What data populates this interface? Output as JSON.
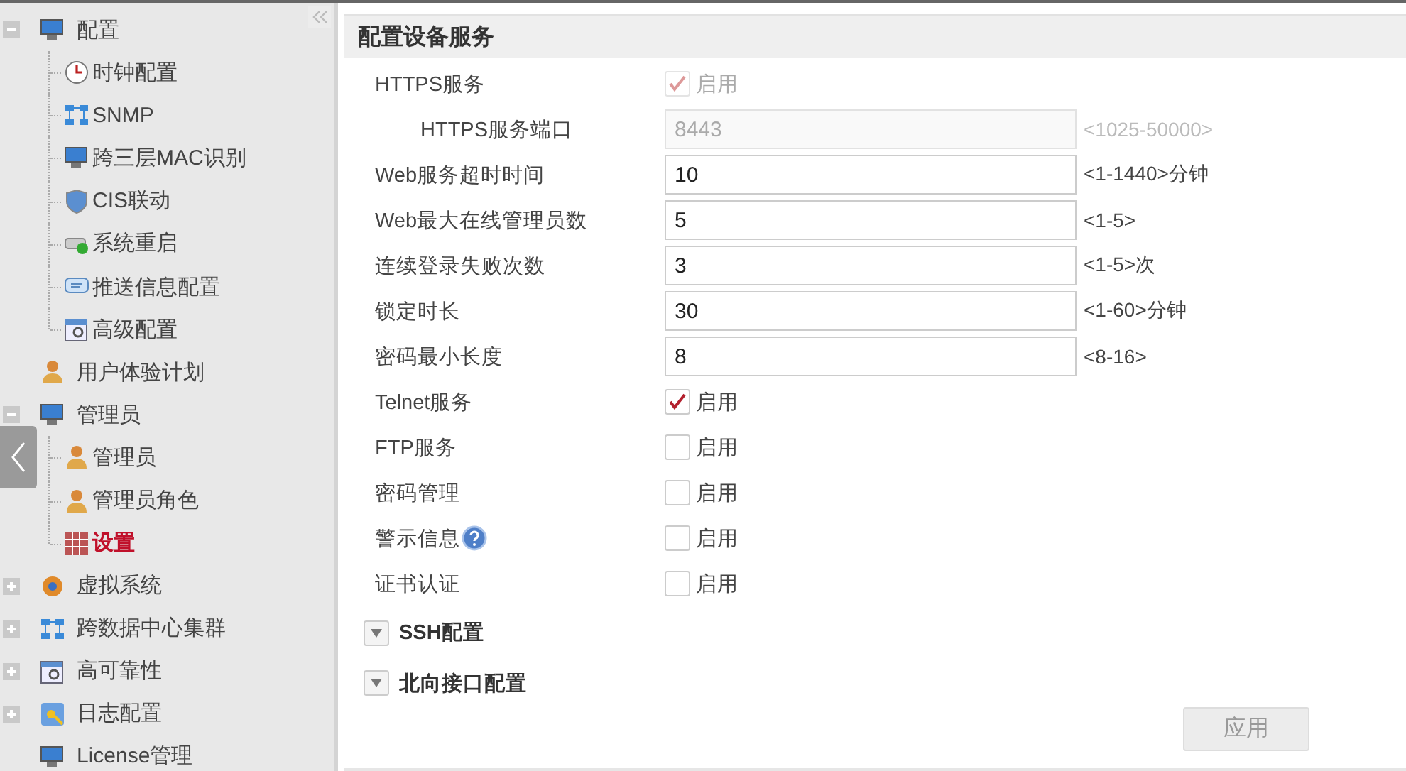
{
  "sidebar": {
    "items": [
      {
        "label": "配置",
        "expanded": true,
        "selected": false,
        "children": [
          {
            "label": "时钟配置",
            "selected": false
          },
          {
            "label": "SNMP",
            "selected": false
          },
          {
            "label": "跨三层MAC识别",
            "selected": false
          },
          {
            "label": "CIS联动",
            "selected": false
          },
          {
            "label": "系统重启",
            "selected": false
          },
          {
            "label": "推送信息配置",
            "selected": false
          },
          {
            "label": "高级配置",
            "selected": false
          }
        ]
      },
      {
        "label": "用户体验计划",
        "selected": false
      },
      {
        "label": "管理员",
        "expanded": true,
        "selected": false,
        "children": [
          {
            "label": "管理员",
            "selected": false
          },
          {
            "label": "管理员角色",
            "selected": false
          },
          {
            "label": "设置",
            "selected": true
          }
        ]
      },
      {
        "label": "虚拟系统",
        "expanded": false,
        "selected": false
      },
      {
        "label": "跨数据中心集群",
        "expanded": false,
        "selected": false
      },
      {
        "label": "高可靠性",
        "expanded": false,
        "selected": false
      },
      {
        "label": "日志配置",
        "expanded": false,
        "selected": false
      },
      {
        "label": "License管理",
        "selected": false
      }
    ]
  },
  "panel": {
    "title": "配置设备服务",
    "rows": [
      {
        "kind": "checkbox",
        "label": "HTTPS服务",
        "checked": true,
        "disabled": true,
        "option": "启用"
      },
      {
        "kind": "input",
        "label": "HTTPS服务端口",
        "sub": true,
        "value": "8443",
        "disabled": true,
        "hint": "<1025-50000>"
      },
      {
        "kind": "input",
        "label": "Web服务超时时间",
        "value": "10",
        "disabled": false,
        "hint": "<1-1440>分钟"
      },
      {
        "kind": "input",
        "label": "Web最大在线管理员数",
        "value": "5",
        "disabled": false,
        "hint": "<1-5>"
      },
      {
        "kind": "input",
        "label": "连续登录失败次数",
        "value": "3",
        "disabled": false,
        "hint": "<1-5>次"
      },
      {
        "kind": "input",
        "label": "锁定时长",
        "value": "30",
        "disabled": false,
        "hint": "<1-60>分钟"
      },
      {
        "kind": "input",
        "label": "密码最小长度",
        "value": "8",
        "disabled": false,
        "hint": "<8-16>"
      },
      {
        "kind": "checkbox",
        "label": "Telnet服务",
        "checked": true,
        "disabled": false,
        "option": "启用"
      },
      {
        "kind": "checkbox",
        "label": "FTP服务",
        "checked": false,
        "disabled": false,
        "option": "启用"
      },
      {
        "kind": "checkbox",
        "label": "密码管理",
        "checked": false,
        "disabled": false,
        "option": "启用"
      },
      {
        "kind": "checkbox",
        "label": "警示信息",
        "help": true,
        "checked": false,
        "disabled": false,
        "option": "启用"
      },
      {
        "kind": "checkbox",
        "label": "证书认证",
        "checked": false,
        "disabled": false,
        "option": "启用"
      }
    ],
    "sections": [
      {
        "label": "SSH配置",
        "expanded": false
      },
      {
        "label": "北向接口配置",
        "expanded": false
      }
    ],
    "apply_button": {
      "label": "应用",
      "disabled": true
    }
  }
}
